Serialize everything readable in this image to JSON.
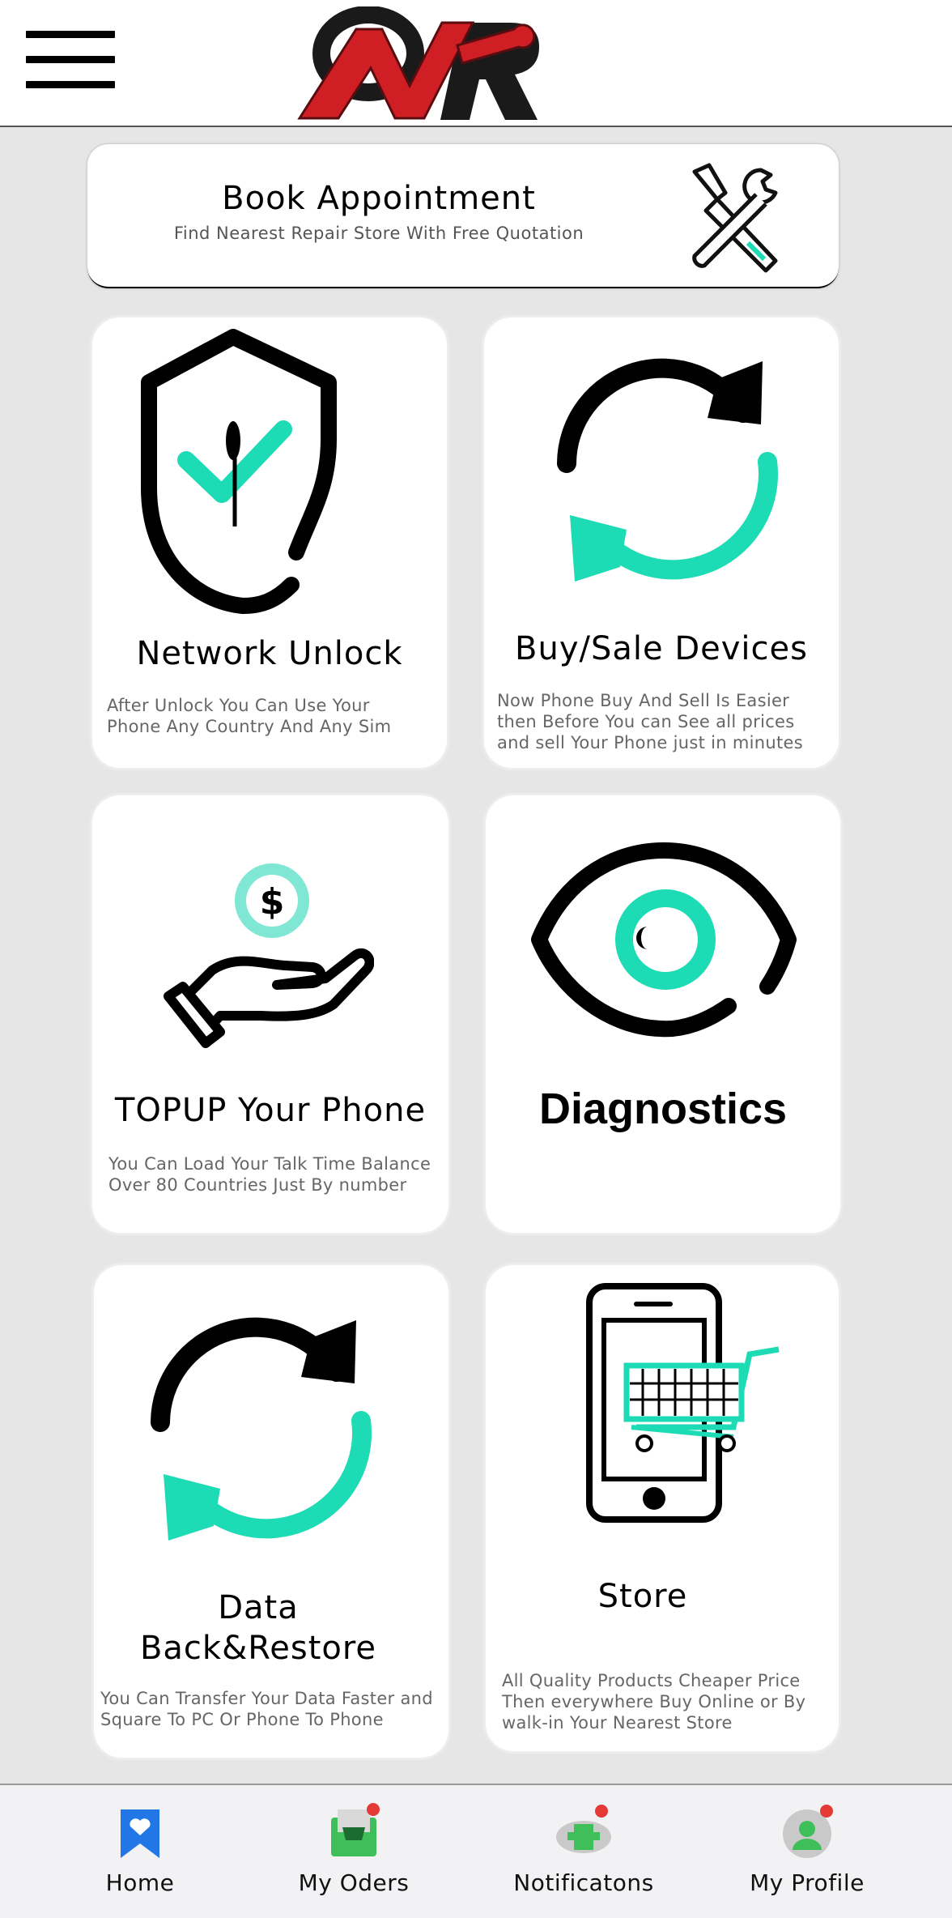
{
  "header": {
    "menu_icon": "hamburger-menu-icon",
    "logo": {
      "icon": "nr-brand-logo",
      "colors": {
        "red": "#d32027",
        "black": "#111111"
      }
    }
  },
  "appointment": {
    "title": "Book Appointment",
    "subtitle": "Find Nearest Repair Store With Free Quotation",
    "icon": "tools-icon"
  },
  "cards": [
    {
      "icon": "shield-check-icon",
      "title": "Network Unlock",
      "description": "After Unlock You Can Use Your Phone Any Country And Any Sim"
    },
    {
      "icon": "sync-arrows-icon",
      "title": "Buy/Sale Devices",
      "description": "Now Phone Buy And Sell Is Easier then Before You can See all prices and sell Your Phone just in minutes"
    },
    {
      "icon": "hand-coin-icon",
      "title": "TOPUP Your Phone",
      "description": "You Can Load Your Talk Time Balance Over 80 Countries Just By number"
    },
    {
      "icon": "eye-icon",
      "title": "Diagnostics",
      "description": ""
    },
    {
      "icon": "backup-sync-icon",
      "title_line1": "Data",
      "title_line2": "Back&Restore",
      "description": "You Can Transfer Your Data Faster and Square To PC Or Phone To Phone"
    },
    {
      "icon": "phone-cart-icon",
      "title": "Store",
      "description": "All Quality Products Cheaper Price Then everywhere Buy Online or By walk-in Your Nearest Store"
    }
  ],
  "bottom_nav": [
    {
      "label": "Home",
      "icon": "home-bookmark-icon"
    },
    {
      "label": "My Oders",
      "icon": "orders-icon",
      "badge": true
    },
    {
      "label": "Notificatons",
      "icon": "notifications-icon",
      "badge": true
    },
    {
      "label": "My Profile",
      "icon": "profile-icon",
      "badge": true
    }
  ],
  "colors": {
    "accent": "#1ddbb4",
    "badge": "#e53935",
    "home_blue": "#2277e6",
    "orders_green": "#3fbf5a"
  }
}
